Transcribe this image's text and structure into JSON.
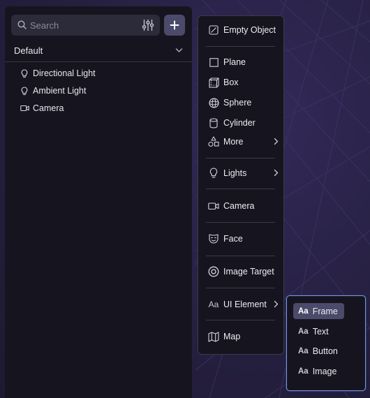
{
  "search": {
    "placeholder": "Search",
    "value": ""
  },
  "add_button": {
    "icon": "plus-icon"
  },
  "section": {
    "label": "Default"
  },
  "tree": [
    {
      "label": "Directional Light",
      "icon": "lightbulb-icon"
    },
    {
      "label": "Ambient Light",
      "icon": "lightbulb-icon"
    },
    {
      "label": "Camera",
      "icon": "camera-icon"
    }
  ],
  "menu": {
    "empty_object": "Empty Object",
    "plane": "Plane",
    "box": "Box",
    "sphere": "Sphere",
    "cylinder": "Cylinder",
    "more": "More",
    "lights": "Lights",
    "camera": "Camera",
    "face": "Face",
    "image_target": "Image Target",
    "ui_element_icon": "Aa",
    "ui_element": "UI Element",
    "map": "Map"
  },
  "submenu": {
    "icon_text": "Aa",
    "items": [
      {
        "label": "Frame",
        "active": true
      },
      {
        "label": "Text",
        "active": false
      },
      {
        "label": "Button",
        "active": false
      },
      {
        "label": "Image",
        "active": false
      }
    ]
  },
  "colors": {
    "panel_bg": "#16151f",
    "accent_active": "#4b4a6a",
    "submenu_border": "#7b95e4",
    "viewport_bg": "#27223d"
  }
}
